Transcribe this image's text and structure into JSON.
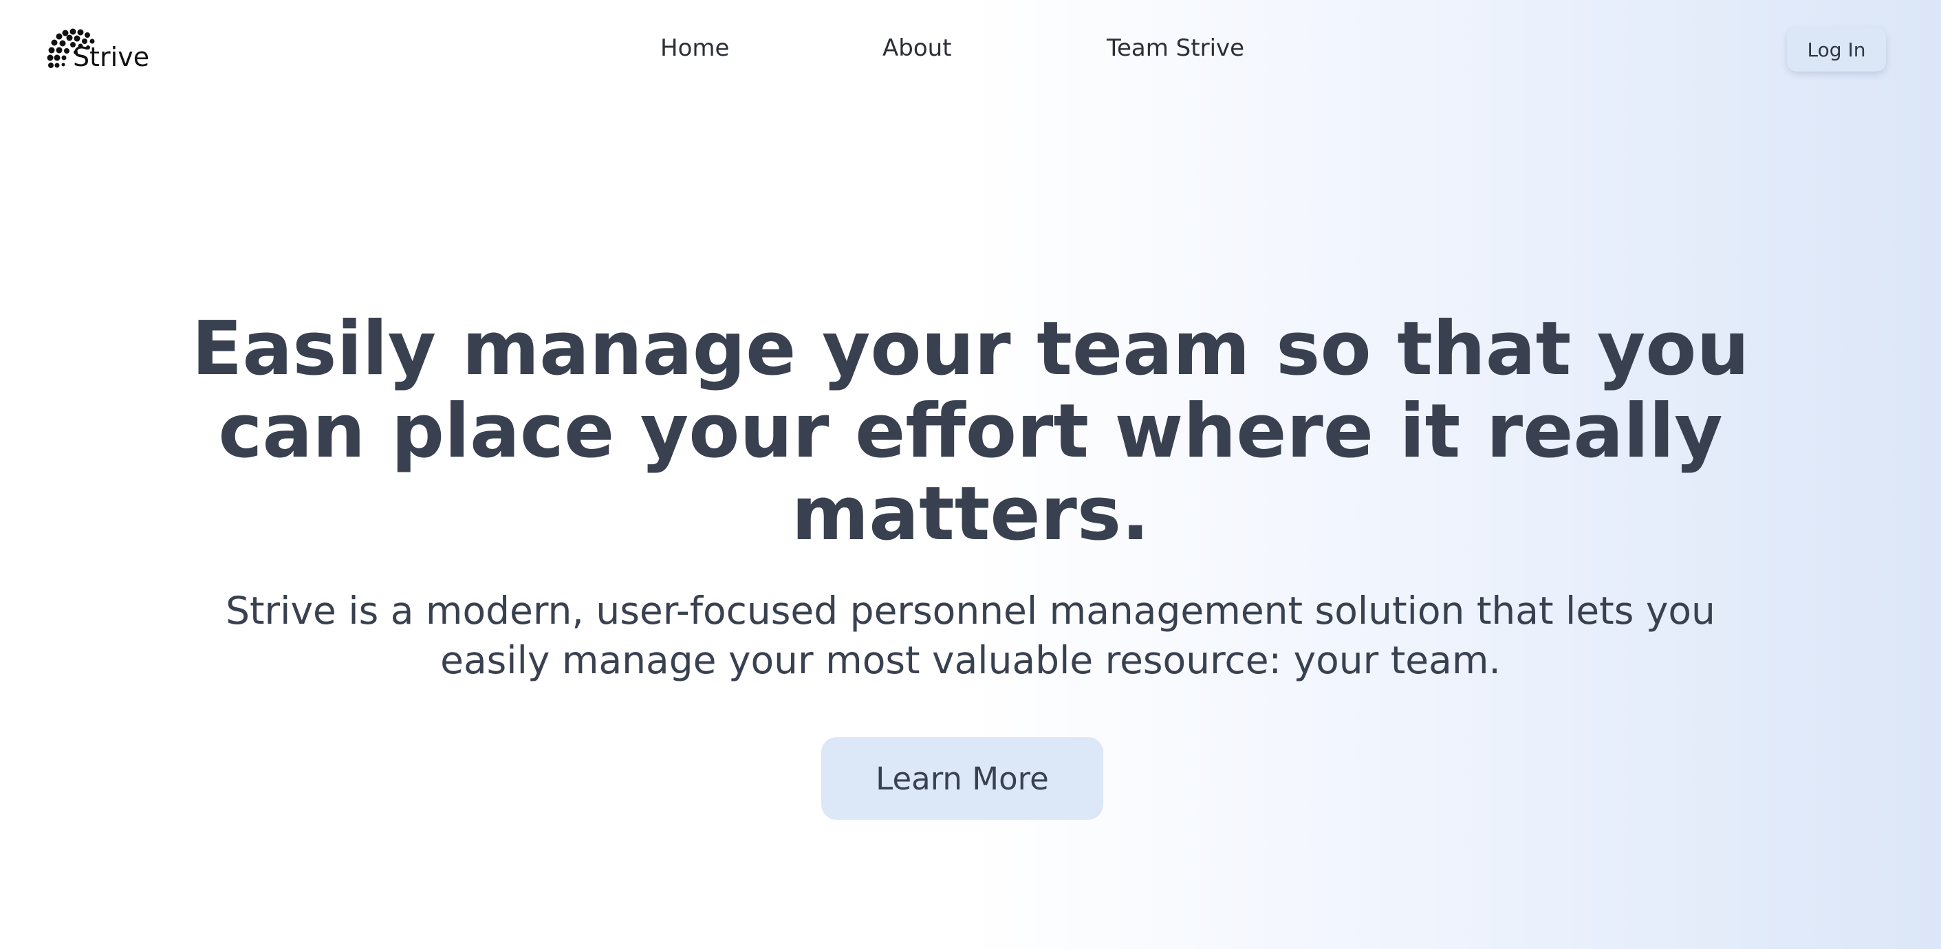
{
  "brand": {
    "name": "Strive",
    "logo_icon": "globe-dots-icon"
  },
  "nav": {
    "items": [
      {
        "label": "Home"
      },
      {
        "label": "About"
      },
      {
        "label": "Team Strive"
      }
    ],
    "login_label": "Log In"
  },
  "hero": {
    "title": "Easily manage your team so that you can place your effort where it really matters.",
    "subtitle": "Strive is a modern, user-focused personnel management solution that lets you easily manage your most valuable resource: your team.",
    "cta_label": "Learn More"
  },
  "colors": {
    "text": "#394150",
    "button_bg": "#dce7f8",
    "gradient_end": "#dbe6f8"
  }
}
